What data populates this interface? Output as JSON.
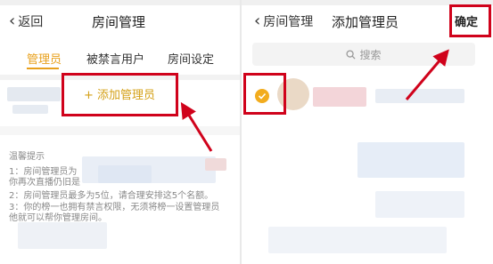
{
  "left": {
    "nav": {
      "back_label": "返回",
      "title": "房间管理"
    },
    "tabs": [
      {
        "label": "管理员"
      },
      {
        "label": "被禁言用户"
      },
      {
        "label": "房间设定"
      }
    ],
    "add_admin_label": "+ 添加管理员",
    "tips": {
      "title": "温馨提示",
      "lines": [
        "1：房间管理员为",
        "你再次直播仍旧是",
        "2：房间管理员最多为5位，请合理安排这5个名额。",
        "3：你的榜一也拥有禁言权限，无须将榜一设置管理员",
        "他就可以帮你管理房间。"
      ]
    }
  },
  "right": {
    "nav": {
      "back_label": "房间管理",
      "title": "添加管理员",
      "confirm_label": "确定"
    },
    "search_placeholder": "搜索"
  },
  "colors": {
    "accent": "#e8a01c",
    "annotation_red": "#d0021b",
    "checkbox": "#f2ac1e"
  }
}
